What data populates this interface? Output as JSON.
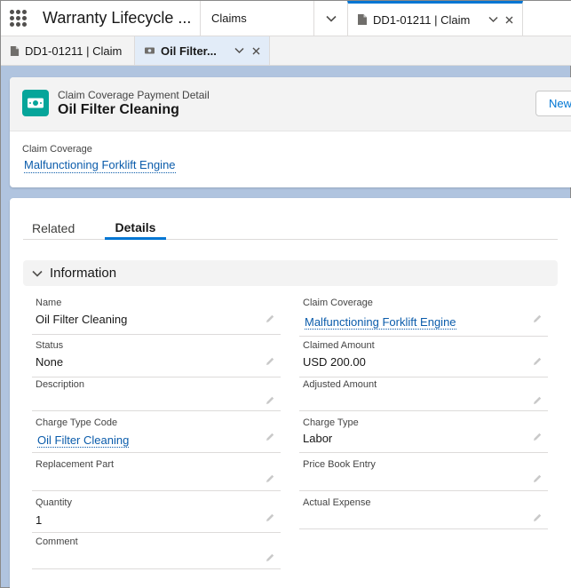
{
  "nav": {
    "app_name": "Warranty Lifecycle ...",
    "claims_tab": "Claims",
    "record_tab": "DD1-01211 | Claim"
  },
  "subtabs": {
    "first": "DD1-01211 | Claim",
    "active": "Oil Filter..."
  },
  "header": {
    "object_type": "Claim Coverage Payment Detail",
    "title": "Oil Filter Cleaning",
    "new_button": "New",
    "highlight_label": "Claim Coverage",
    "highlight_value": "Malfunctioning Forklift Engine"
  },
  "tabs": {
    "related": "Related",
    "details": "Details"
  },
  "section": {
    "title": "Information"
  },
  "fields": {
    "name": {
      "label": "Name",
      "value": "Oil Filter Cleaning"
    },
    "claim_coverage": {
      "label": "Claim Coverage",
      "value": "Malfunctioning Forklift Engine"
    },
    "status": {
      "label": "Status",
      "value": "None"
    },
    "claimed_amount": {
      "label": "Claimed Amount",
      "value": "USD 200.00"
    },
    "description": {
      "label": "Description",
      "value": ""
    },
    "adjusted_amount": {
      "label": "Adjusted Amount",
      "value": ""
    },
    "charge_type_code": {
      "label": "Charge Type Code",
      "value": "Oil Filter Cleaning"
    },
    "charge_type": {
      "label": "Charge Type",
      "value": "Labor"
    },
    "replacement_part": {
      "label": "Replacement Part",
      "value": ""
    },
    "price_book_entry": {
      "label": "Price Book Entry",
      "value": ""
    },
    "quantity": {
      "label": "Quantity",
      "value": "1"
    },
    "actual_expense": {
      "label": "Actual Expense",
      "value": ""
    },
    "comment": {
      "label": "Comment",
      "value": ""
    }
  },
  "icons": {
    "app_launcher": "waffle-grid-icon",
    "record_tab": "document-icon",
    "object": "money-icon",
    "edit": "pencil-icon"
  },
  "colors": {
    "brand_blue": "#0176d3",
    "link": "#0b5cab",
    "object_icon": "#06a59a",
    "background": "#b0c4df"
  }
}
